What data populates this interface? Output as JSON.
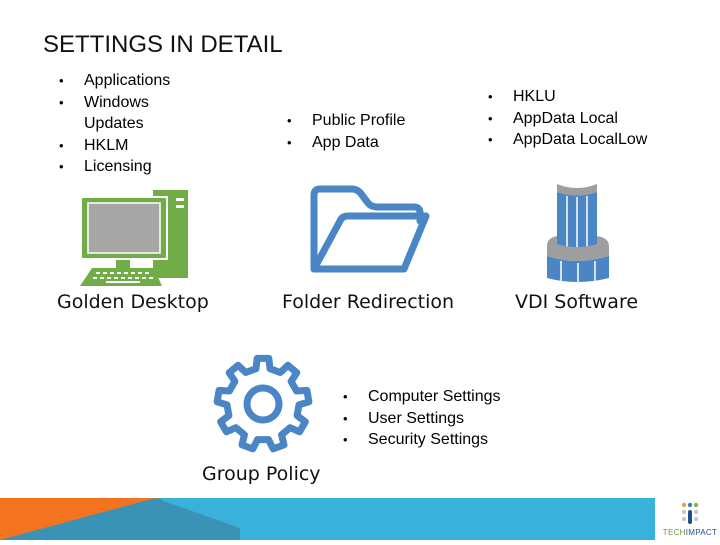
{
  "slide": {
    "title": "SETTINGS IN DETAIL"
  },
  "golden_desktop": {
    "caption": "Golden Desktop",
    "icon": "desktop-computer-icon",
    "bullets": [
      "Applications",
      "Windows Updates",
      "HKLM",
      "Licensing"
    ]
  },
  "folder_redirection": {
    "caption": "Folder Redirection",
    "icon": "folder-open-icon",
    "bullets": [
      "Public Profile",
      "App Data"
    ]
  },
  "vdi_software": {
    "caption": "VDI Software",
    "icon": "vdi-tower-icon",
    "bullets": [
      "HKLU",
      "AppData Local",
      "AppData LocalLow"
    ]
  },
  "group_policy": {
    "caption": "Group Policy",
    "icon": "gear-icon",
    "bullets": [
      "Computer Settings",
      "User Settings",
      "Security Settings"
    ]
  },
  "footer": {
    "logo_text_a": "TECH",
    "logo_text_b": "IMPACT"
  },
  "colors": {
    "green": "#70ad47",
    "blue": "#4a86c5",
    "screen_gray": "#a6a6a6",
    "orange": "#f4731f",
    "teal": "#3a93b5",
    "sky": "#3ab0dc"
  }
}
